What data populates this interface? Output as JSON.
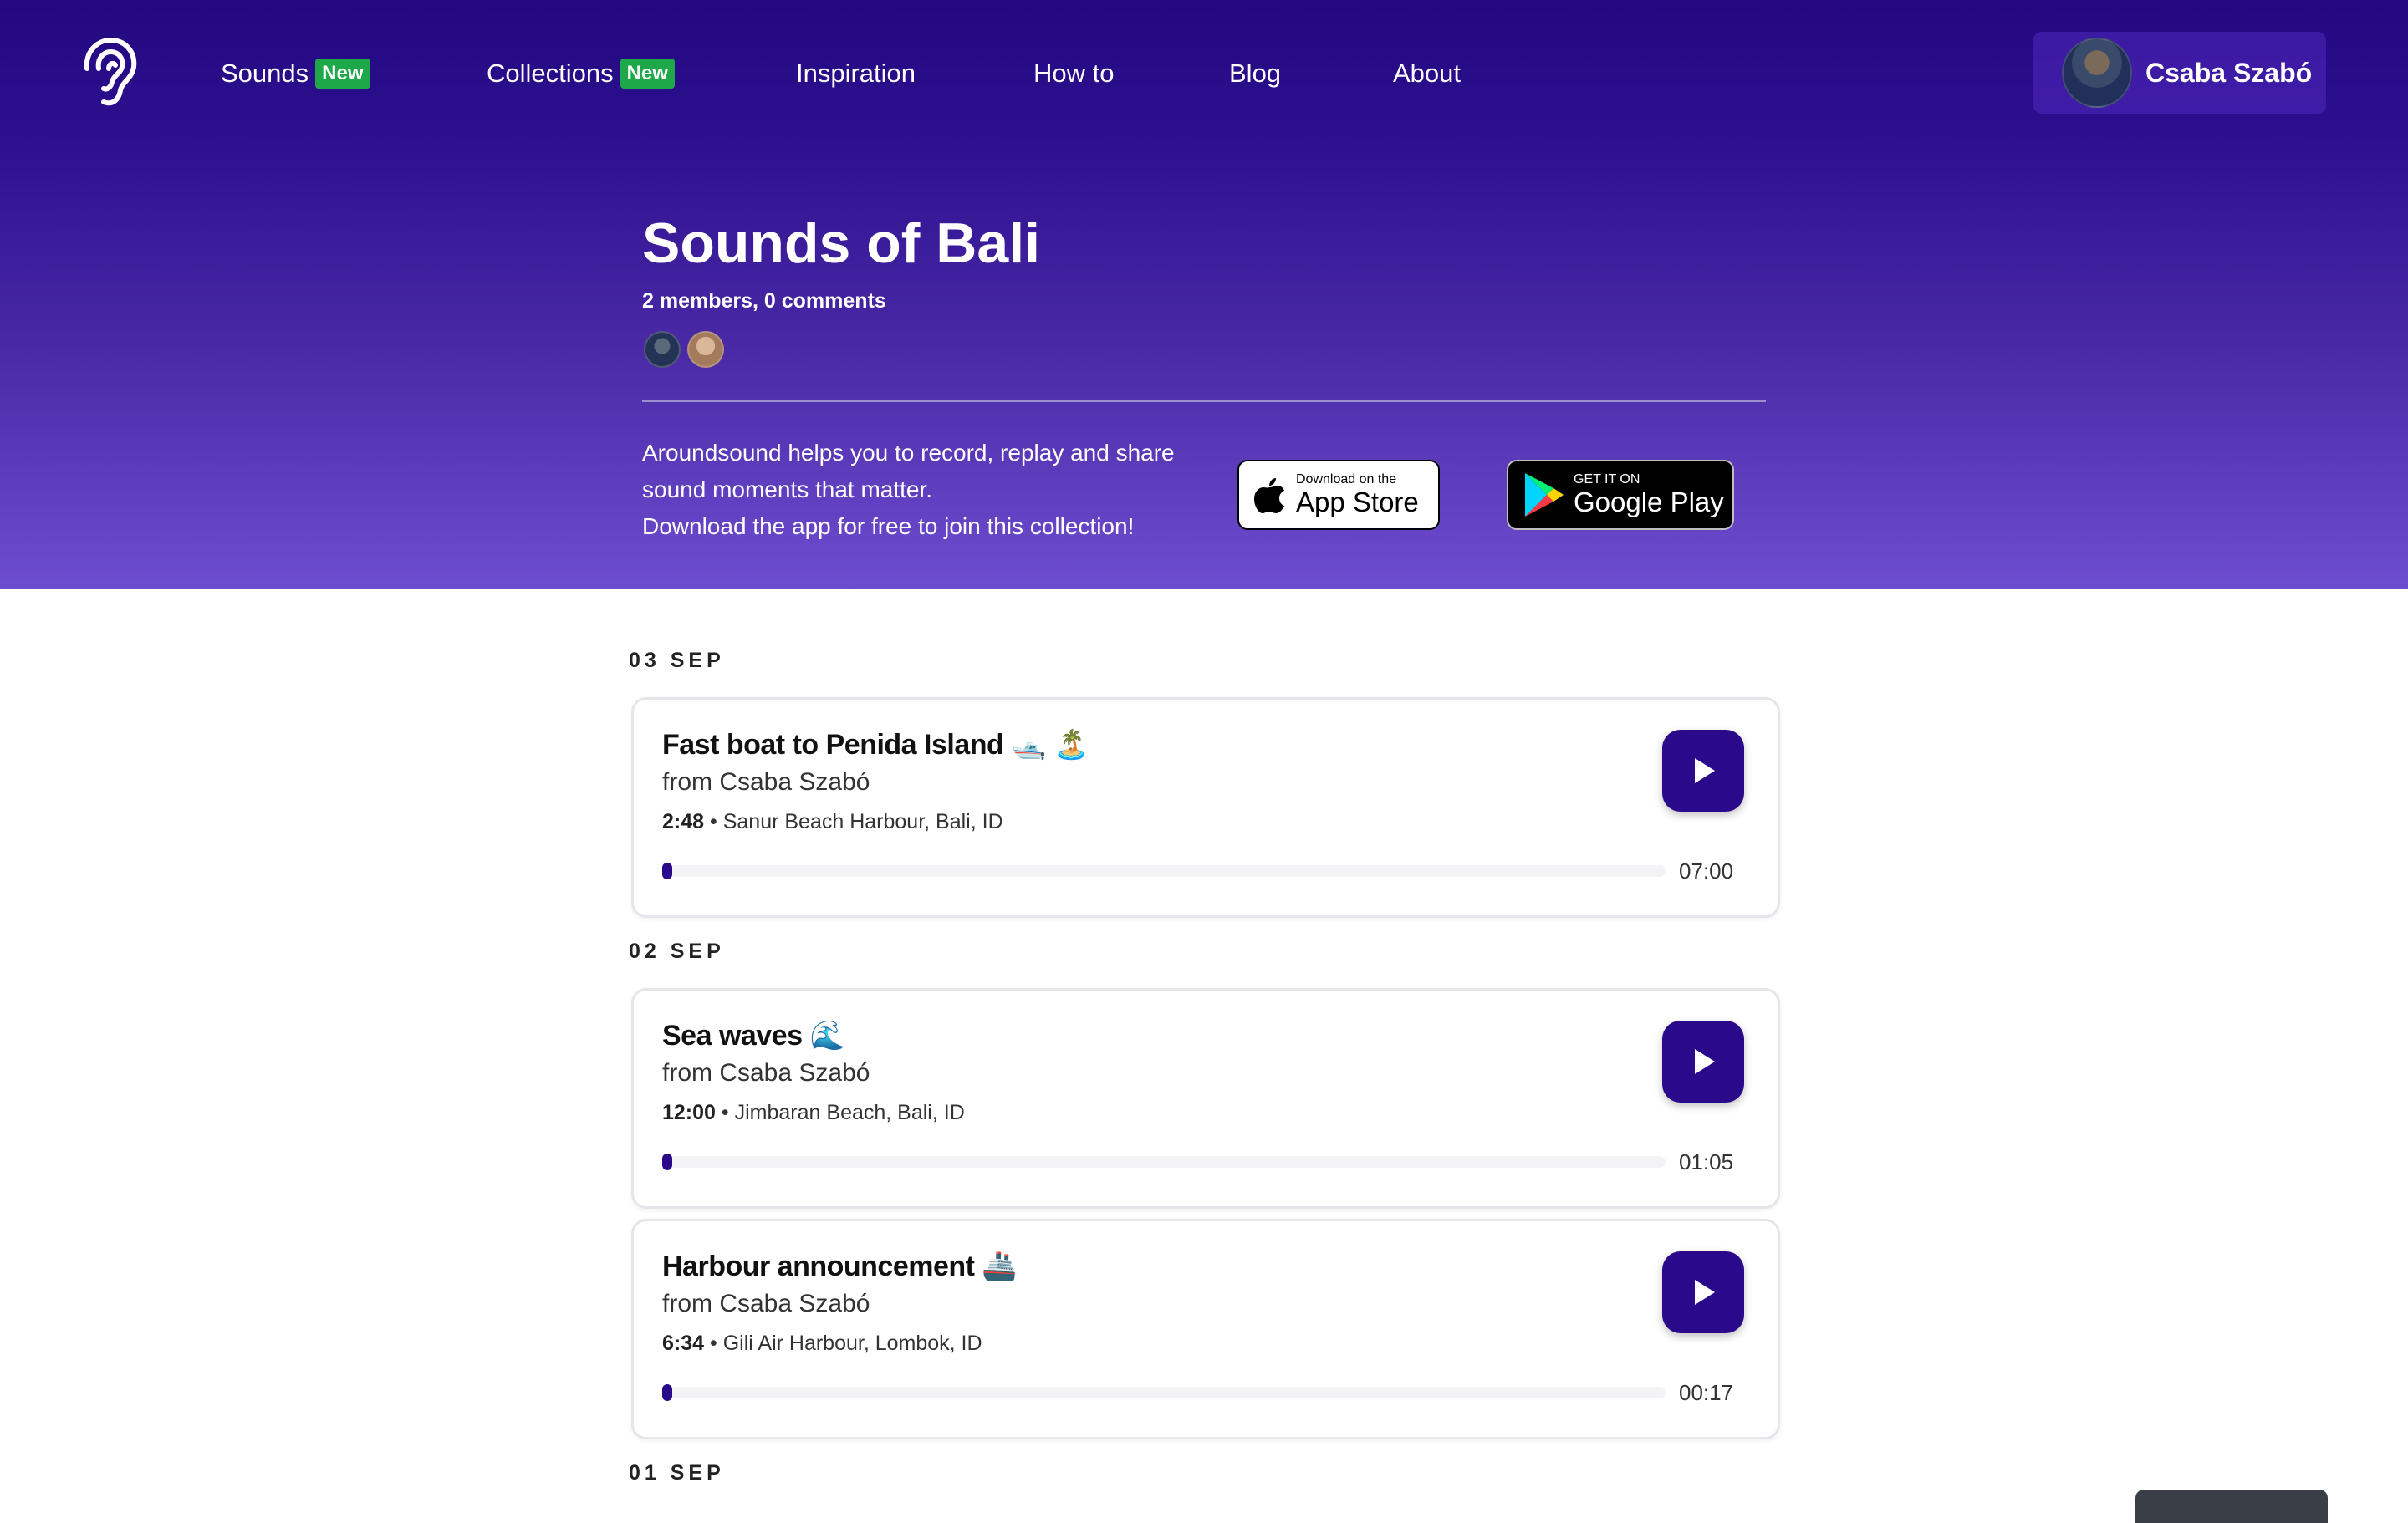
{
  "nav": {
    "items": [
      {
        "label": "Sounds",
        "badge": "New"
      },
      {
        "label": "Collections",
        "badge": "New"
      },
      {
        "label": "Inspiration"
      },
      {
        "label": "How to"
      },
      {
        "label": "Blog"
      },
      {
        "label": "About"
      }
    ],
    "user": {
      "name": "Csaba Szabó"
    }
  },
  "collection": {
    "title": "Sounds of Bali",
    "meta": "2 members, 0 comments"
  },
  "promo": {
    "line1": "Aroundsound helps you to record, replay and share",
    "line2": "sound moments that matter.",
    "line3": "Download the app for free to join this collection!"
  },
  "stores": {
    "apple": {
      "small": "Download on the",
      "big": "App Store"
    },
    "google": {
      "small": "GET IT ON",
      "big": "Google Play"
    }
  },
  "feed": {
    "days": [
      {
        "label": "03 SEP"
      },
      {
        "label": "02 SEP"
      },
      {
        "label": "01 SEP"
      }
    ],
    "sounds": [
      {
        "title": "Fast boat to Penida Island 🛥️ 🏝️",
        "from": "from Csaba Szabó",
        "time": "2:48",
        "location": "Sanur Beach Harbour, Bali, ID",
        "duration": "07:00",
        "progress": 0.005
      },
      {
        "title": "Sea waves 🌊",
        "from": "from Csaba Szabó",
        "time": "12:00",
        "location": "Jimbaran Beach, Bali, ID",
        "duration": "01:05",
        "progress": 0.005
      },
      {
        "title": "Harbour announcement 🚢",
        "from": "from Csaba Szabó",
        "time": "6:34",
        "location": "Gili Air Harbour, Lombok, ID",
        "duration": "00:17",
        "progress": 0.005
      }
    ],
    "separator": "•"
  },
  "colors": {
    "accent": "#2a0a8a",
    "badge": "#1ea84a",
    "hero_top": "#230880",
    "hero_bottom": "#6e4ed0"
  }
}
